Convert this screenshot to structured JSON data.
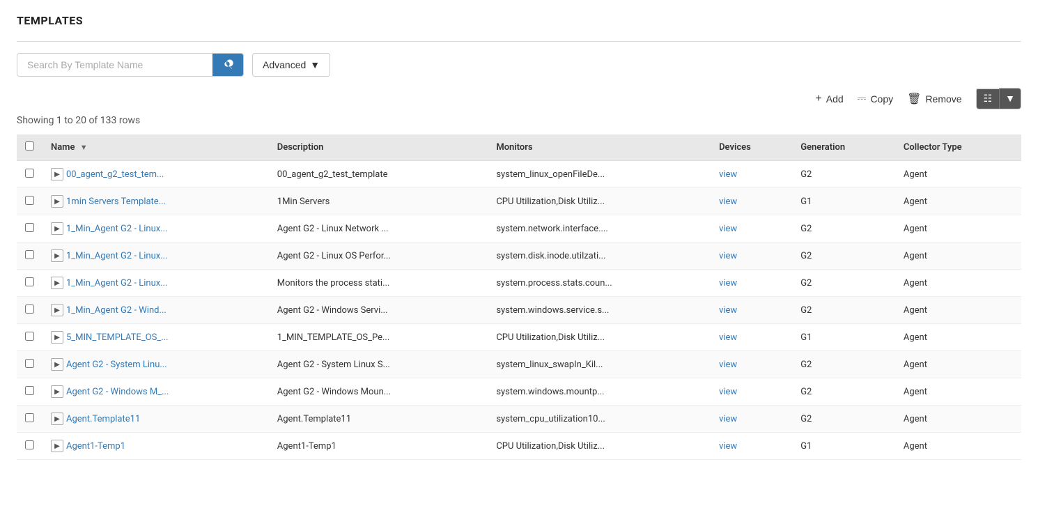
{
  "page": {
    "title": "TEMPLATES"
  },
  "search": {
    "placeholder": "Search By Template Name",
    "value": ""
  },
  "advanced_button": {
    "label": "Advanced"
  },
  "actions": {
    "add_label": "Add",
    "copy_label": "Copy",
    "remove_label": "Remove"
  },
  "row_count": "Showing 1 to 20 of 133 rows",
  "table": {
    "columns": [
      {
        "key": "name",
        "label": "Name",
        "sortable": true
      },
      {
        "key": "description",
        "label": "Description",
        "sortable": false
      },
      {
        "key": "monitors",
        "label": "Monitors",
        "sortable": false
      },
      {
        "key": "devices",
        "label": "Devices",
        "sortable": false
      },
      {
        "key": "generation",
        "label": "Generation",
        "sortable": false
      },
      {
        "key": "collector_type",
        "label": "Collector Type",
        "sortable": false
      }
    ],
    "rows": [
      {
        "name": "00_agent_g2_test_tem...",
        "description": "00_agent_g2_test_template",
        "monitors": "system_linux_openFileDe...",
        "devices": "view",
        "generation": "G2",
        "collector_type": "Agent"
      },
      {
        "name": "1min Servers Template...",
        "description": "1Min Servers",
        "monitors": "CPU Utilization,Disk Utiliz...",
        "devices": "view",
        "generation": "G1",
        "collector_type": "Agent"
      },
      {
        "name": "1_Min_Agent G2 - Linux...",
        "description": "Agent G2 - Linux Network ...",
        "monitors": "system.network.interface....",
        "devices": "view",
        "generation": "G2",
        "collector_type": "Agent"
      },
      {
        "name": "1_Min_Agent G2 - Linux...",
        "description": "Agent G2 - Linux OS Perfor...",
        "monitors": "system.disk.inode.utilzati...",
        "devices": "view",
        "generation": "G2",
        "collector_type": "Agent"
      },
      {
        "name": "1_Min_Agent G2 - Linux...",
        "description": "Monitors the process stati...",
        "monitors": "system.process.stats.coun...",
        "devices": "view",
        "generation": "G2",
        "collector_type": "Agent"
      },
      {
        "name": "1_Min_Agent G2 - Wind...",
        "description": "Agent G2 - Windows Servi...",
        "monitors": "system.windows.service.s...",
        "devices": "view",
        "generation": "G2",
        "collector_type": "Agent"
      },
      {
        "name": "5_MIN_TEMPLATE_OS_...",
        "description": "1_MIN_TEMPLATE_OS_Pe...",
        "monitors": "CPU Utilization,Disk Utiliz...",
        "devices": "view",
        "generation": "G1",
        "collector_type": "Agent"
      },
      {
        "name": "Agent G2 - System Linu...",
        "description": "Agent G2 - System Linux S...",
        "monitors": "system_linux_swapIn_Kil...",
        "devices": "view",
        "generation": "G2",
        "collector_type": "Agent"
      },
      {
        "name": "Agent G2 - Windows M_...",
        "description": "Agent G2 - Windows Moun...",
        "monitors": "system.windows.mountp...",
        "devices": "view",
        "generation": "G2",
        "collector_type": "Agent"
      },
      {
        "name": "Agent.Template11",
        "description": "Agent.Template11",
        "monitors": "system_cpu_utilization10...",
        "devices": "view",
        "generation": "G2",
        "collector_type": "Agent"
      },
      {
        "name": "Agent1-Temp1",
        "description": "Agent1-Temp1",
        "monitors": "CPU Utilization,Disk Utiliz...",
        "devices": "view",
        "generation": "G1",
        "collector_type": "Agent"
      }
    ]
  }
}
